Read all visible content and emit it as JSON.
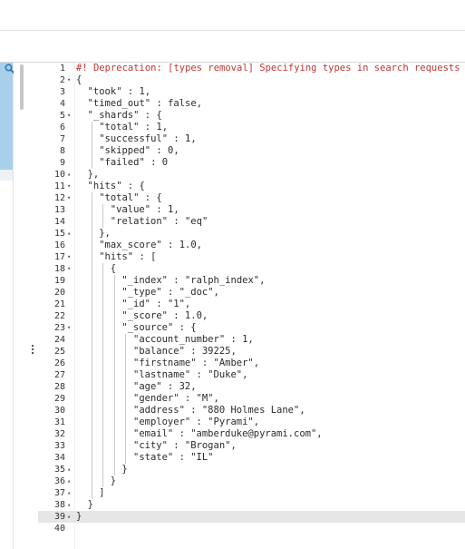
{
  "editor": {
    "lines": [
      {
        "num": "1",
        "fold": "",
        "indent": 0,
        "text": "#! Deprecation: [types removal] Specifying types in search requests is",
        "style": "comment"
      },
      {
        "num": "2",
        "fold": "▾",
        "indent": 0,
        "text": "{"
      },
      {
        "num": "3",
        "fold": "",
        "indent": 1,
        "text": "\"took\" : 1,"
      },
      {
        "num": "4",
        "fold": "",
        "indent": 1,
        "text": "\"timed_out\" : false,"
      },
      {
        "num": "5",
        "fold": "▾",
        "indent": 1,
        "text": "\"_shards\" : {"
      },
      {
        "num": "6",
        "fold": "",
        "indent": 2,
        "text": "\"total\" : 1,"
      },
      {
        "num": "7",
        "fold": "",
        "indent": 2,
        "text": "\"successful\" : 1,"
      },
      {
        "num": "8",
        "fold": "",
        "indent": 2,
        "text": "\"skipped\" : 0,"
      },
      {
        "num": "9",
        "fold": "",
        "indent": 2,
        "text": "\"failed\" : 0"
      },
      {
        "num": "10",
        "fold": "▴",
        "indent": 1,
        "text": "},"
      },
      {
        "num": "11",
        "fold": "▾",
        "indent": 1,
        "text": "\"hits\" : {"
      },
      {
        "num": "12",
        "fold": "▾",
        "indent": 2,
        "text": "\"total\" : {"
      },
      {
        "num": "13",
        "fold": "",
        "indent": 3,
        "text": "\"value\" : 1,"
      },
      {
        "num": "14",
        "fold": "",
        "indent": 3,
        "text": "\"relation\" : \"eq\""
      },
      {
        "num": "15",
        "fold": "▴",
        "indent": 2,
        "text": "},"
      },
      {
        "num": "16",
        "fold": "",
        "indent": 2,
        "text": "\"max_score\" : 1.0,"
      },
      {
        "num": "17",
        "fold": "▾",
        "indent": 2,
        "text": "\"hits\" : ["
      },
      {
        "num": "18",
        "fold": "▾",
        "indent": 3,
        "text": "{"
      },
      {
        "num": "19",
        "fold": "",
        "indent": 4,
        "text": "\"_index\" : \"ralph_index\","
      },
      {
        "num": "20",
        "fold": "",
        "indent": 4,
        "text": "\"_type\" : \"_doc\","
      },
      {
        "num": "21",
        "fold": "",
        "indent": 4,
        "text": "\"_id\" : \"1\","
      },
      {
        "num": "22",
        "fold": "",
        "indent": 4,
        "text": "\"_score\" : 1.0,"
      },
      {
        "num": "23",
        "fold": "▾",
        "indent": 4,
        "text": "\"_source\" : {"
      },
      {
        "num": "24",
        "fold": "",
        "indent": 5,
        "text": "\"account_number\" : 1,"
      },
      {
        "num": "25",
        "fold": "",
        "indent": 5,
        "text": "\"balance\" : 39225,"
      },
      {
        "num": "26",
        "fold": "",
        "indent": 5,
        "text": "\"firstname\" : \"Amber\","
      },
      {
        "num": "27",
        "fold": "",
        "indent": 5,
        "text": "\"lastname\" : \"Duke\","
      },
      {
        "num": "28",
        "fold": "",
        "indent": 5,
        "text": "\"age\" : 32,"
      },
      {
        "num": "29",
        "fold": "",
        "indent": 5,
        "text": "\"gender\" : \"M\","
      },
      {
        "num": "30",
        "fold": "",
        "indent": 5,
        "text": "\"address\" : \"880 Holmes Lane\","
      },
      {
        "num": "31",
        "fold": "",
        "indent": 5,
        "text": "\"employer\" : \"Pyrami\","
      },
      {
        "num": "32",
        "fold": "",
        "indent": 5,
        "text": "\"email\" : \"amberduke@pyrami.com\","
      },
      {
        "num": "33",
        "fold": "",
        "indent": 5,
        "text": "\"city\" : \"Brogan\","
      },
      {
        "num": "34",
        "fold": "",
        "indent": 5,
        "text": "\"state\" : \"IL\""
      },
      {
        "num": "35",
        "fold": "▴",
        "indent": 4,
        "text": "}"
      },
      {
        "num": "36",
        "fold": "▴",
        "indent": 3,
        "text": "}"
      },
      {
        "num": "37",
        "fold": "▴",
        "indent": 2,
        "text": "]"
      },
      {
        "num": "38",
        "fold": "▴",
        "indent": 1,
        "text": "}"
      },
      {
        "num": "39",
        "fold": "▴",
        "indent": 0,
        "text": "}",
        "active": true
      },
      {
        "num": "40",
        "fold": "",
        "indent": 0,
        "text": ""
      }
    ]
  },
  "icons": {
    "tool": "wrench-icon",
    "divider": "drag-handle-icon"
  },
  "colors": {
    "comment": "#c03535",
    "active_line": "#e6e6e6",
    "scroll_thumb": "#a9d0ea"
  }
}
